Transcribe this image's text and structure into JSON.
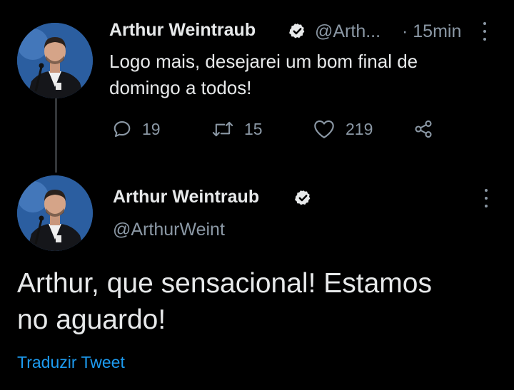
{
  "tweet": {
    "author_name": "Arthur Weintraub",
    "handle_truncated": "@Arth...",
    "time": "· 15min",
    "text_line1": "Logo mais, desejarei um bom final de",
    "text_line2": "domingo a todos!",
    "replies": "19",
    "retweets": "15",
    "likes": "219"
  },
  "reply": {
    "author_name": "Arthur Weintraub",
    "handle": "@ArthurWeint",
    "text_line1": "Arthur, que sensacional! Estamos",
    "text_line2": "no aguardo!",
    "translate_label": "Traduzir Tweet"
  },
  "icons": {
    "verified": "verified-badge-icon",
    "more": "more-vertical-icon",
    "reply": "reply-icon",
    "retweet": "retweet-icon",
    "like": "heart-icon",
    "share": "share-icon"
  },
  "colors": {
    "background": "#000000",
    "text_primary": "#e7e9ea",
    "text_secondary": "#8b98a5",
    "link": "#1d9bf0",
    "thread_line": "#333639"
  }
}
